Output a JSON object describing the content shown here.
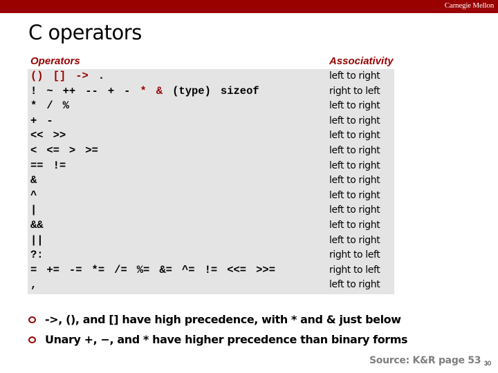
{
  "header": {
    "brand": "Carnegie Mellon"
  },
  "slide": {
    "title": "C operators",
    "page_number": "30"
  },
  "table": {
    "operators_header": "Operators",
    "associativity_header": "Associativity",
    "rows": [
      {
        "tokens": [
          {
            "t": "()",
            "red": true
          },
          {
            "t": "[]",
            "red": true
          },
          {
            "t": "->",
            "red": true
          },
          {
            "t": ".",
            "red": false
          }
        ],
        "assoc": "left to right"
      },
      {
        "tokens": [
          {
            "t": "!",
            "red": false
          },
          {
            "t": "~",
            "red": false
          },
          {
            "t": "++",
            "red": false
          },
          {
            "t": "--",
            "red": false
          },
          {
            "t": "+",
            "red": false
          },
          {
            "t": "-",
            "red": false
          },
          {
            "t": "*",
            "red": true
          },
          {
            "t": "&",
            "red": true
          },
          {
            "t": "(type)",
            "red": false
          },
          {
            "t": "sizeof",
            "red": false
          }
        ],
        "assoc": "right to left"
      },
      {
        "tokens": [
          {
            "t": "*",
            "red": false
          },
          {
            "t": "/",
            "red": false
          },
          {
            "t": "%",
            "red": false
          }
        ],
        "assoc": "left to right"
      },
      {
        "tokens": [
          {
            "t": "+",
            "red": false
          },
          {
            "t": "-",
            "red": false
          }
        ],
        "assoc": "left to right"
      },
      {
        "tokens": [
          {
            "t": "<<",
            "red": false
          },
          {
            "t": ">>",
            "red": false
          }
        ],
        "assoc": "left to right"
      },
      {
        "tokens": [
          {
            "t": "<",
            "red": false
          },
          {
            "t": "<=",
            "red": false
          },
          {
            "t": ">",
            "red": false
          },
          {
            "t": ">=",
            "red": false
          }
        ],
        "assoc": "left to right"
      },
      {
        "tokens": [
          {
            "t": "==",
            "red": false
          },
          {
            "t": "!=",
            "red": false
          }
        ],
        "assoc": "left to right"
      },
      {
        "tokens": [
          {
            "t": "&",
            "red": false
          }
        ],
        "assoc": "left to right"
      },
      {
        "tokens": [
          {
            "t": "^",
            "red": false
          }
        ],
        "assoc": "left to right"
      },
      {
        "tokens": [
          {
            "t": "|",
            "red": false
          }
        ],
        "assoc": "left to right"
      },
      {
        "tokens": [
          {
            "t": "&&",
            "red": false
          }
        ],
        "assoc": "left to right"
      },
      {
        "tokens": [
          {
            "t": "||",
            "red": false
          }
        ],
        "assoc": "left to right"
      },
      {
        "tokens": [
          {
            "t": "?:",
            "red": false
          }
        ],
        "assoc": "right to left"
      },
      {
        "tokens": [
          {
            "t": "=",
            "red": false
          },
          {
            "t": "+=",
            "red": false
          },
          {
            "t": "-=",
            "red": false
          },
          {
            "t": "*=",
            "red": false
          },
          {
            "t": "/=",
            "red": false
          },
          {
            "t": "%=",
            "red": false
          },
          {
            "t": "&=",
            "red": false
          },
          {
            "t": "^=",
            "red": false
          },
          {
            "t": "!=",
            "red": false
          },
          {
            "t": "<<=",
            "red": false
          },
          {
            "t": ">>=",
            "red": false
          }
        ],
        "assoc": "right to left"
      },
      {
        "tokens": [
          {
            "t": ",",
            "red": false
          }
        ],
        "assoc": "left to right"
      }
    ]
  },
  "bullets": [
    "->, (), and [] have high precedence, with * and & just below",
    "Unary +,  −, and * have higher precedence than binary forms"
  ],
  "footer": {
    "source": "Source: K&R page 53"
  },
  "colors": {
    "brand_red": "#990000",
    "table_bg": "#e4e4e4",
    "source_gray": "#7f7f7f"
  }
}
